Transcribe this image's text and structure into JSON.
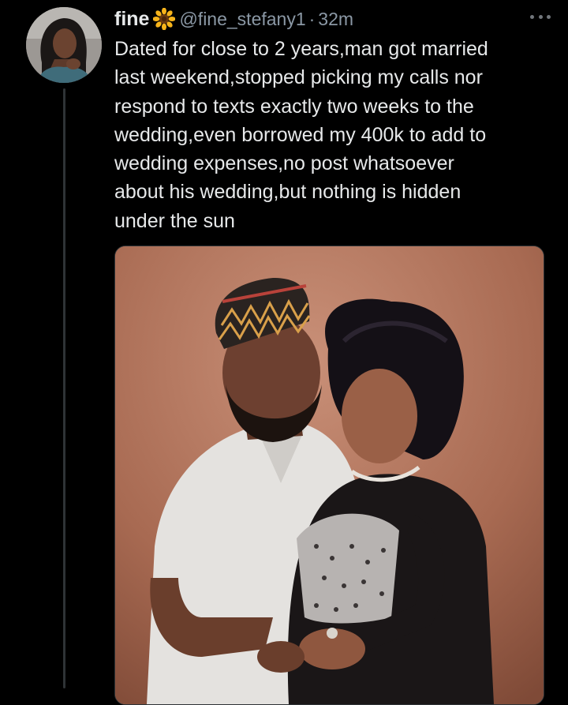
{
  "tweet": {
    "display_name": "fine",
    "handle": "@fine_stefany1",
    "separator": "·",
    "time": "32m",
    "text_lines": [
      "Dated for close to 2 years,man got married",
      "last weekend,stopped picking my calls nor",
      "respond to texts exactly two weeks to the",
      "wedding,even borrowed my 400k to add to",
      "wedding expenses,no post whatsoever",
      "about his wedding,but nothing is hidden",
      "under the sun"
    ],
    "avatar_icon": "avatar",
    "badge_icon": "sunflower-icon",
    "more_icon": "more-options-icon",
    "media_icon": "wedding-couple-photo"
  },
  "colors": {
    "background": "#000000",
    "text_primary": "#e7e9ea",
    "text_secondary": "#8b98a5",
    "thread_line": "#2f3336"
  }
}
